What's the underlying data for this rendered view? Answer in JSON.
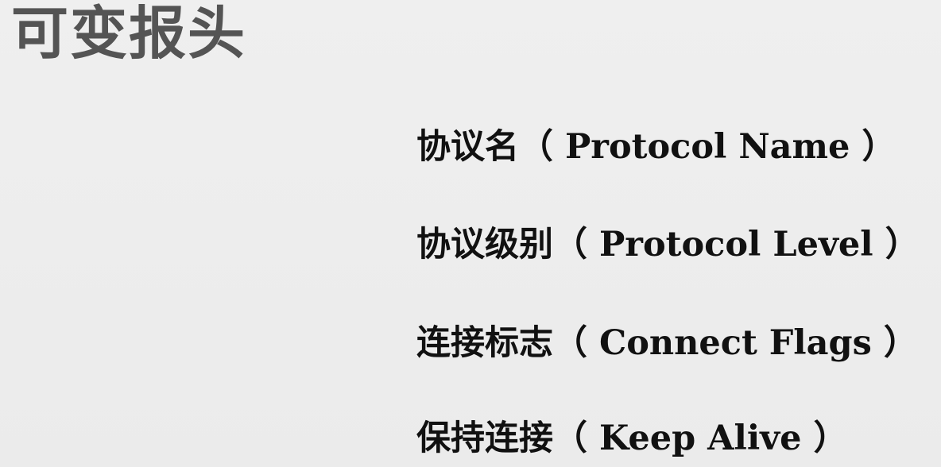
{
  "slide": {
    "title": "可变报头",
    "items": [
      "协议名（ Protocol Name ）",
      "协议级别（ Protocol Level ）",
      "连接标志（ Connect Flags ）",
      "保持连接（ Keep Alive ）"
    ]
  }
}
